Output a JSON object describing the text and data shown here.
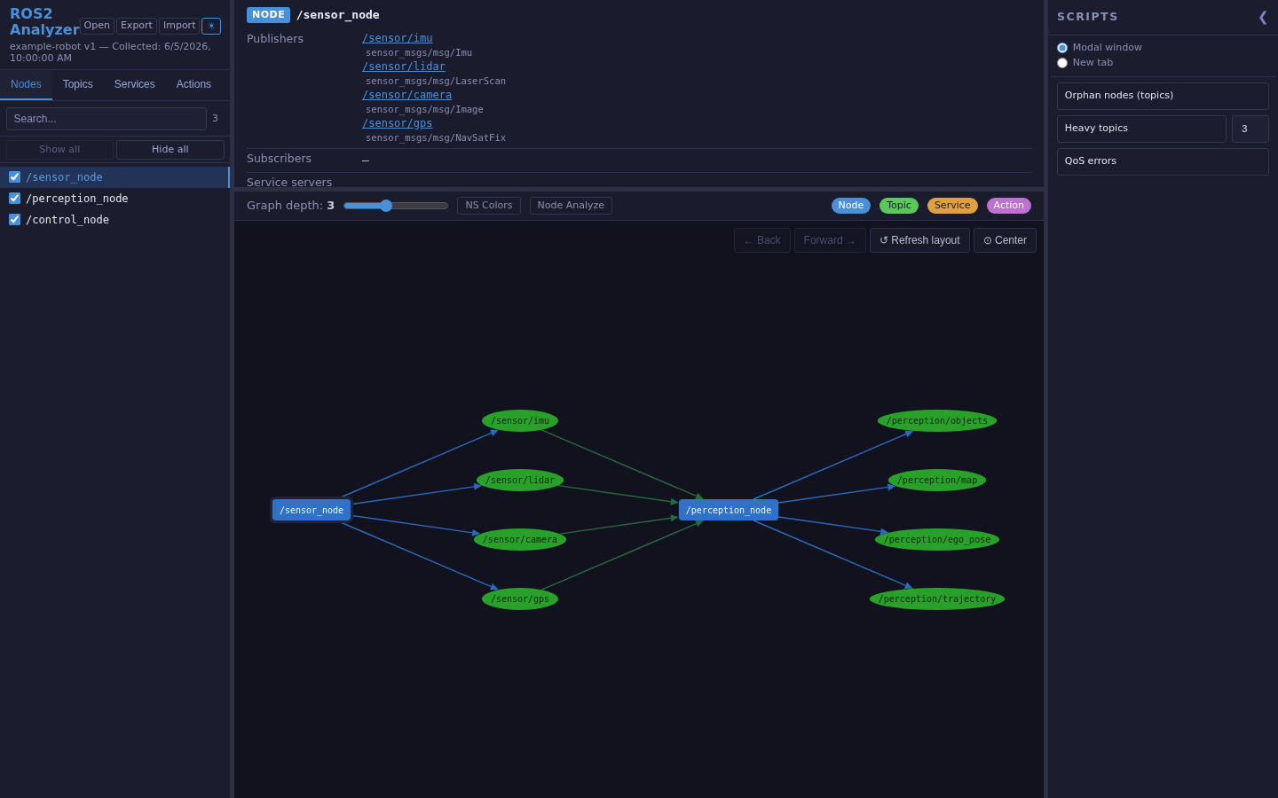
{
  "app": {
    "title": "ROS2 Analyzer",
    "subtitle": "example-robot v1 — Collected: 6/5/2026, 10:00:00 AM",
    "file_buttons": [
      "Open",
      "Export",
      "Import"
    ],
    "theme_toggle": "☀"
  },
  "tabs": [
    {
      "label": "Nodes",
      "selected": true
    },
    {
      "label": "Topics",
      "selected": false
    },
    {
      "label": "Services",
      "selected": false
    },
    {
      "label": "Actions",
      "selected": false
    }
  ],
  "search": {
    "placeholder": "Search...",
    "count": "3"
  },
  "visibility_buttons": [
    {
      "label": "Show all",
      "disabled": true
    },
    {
      "label": "Hide all",
      "disabled": false
    }
  ],
  "node_list": [
    {
      "label": "/sensor_node",
      "checked": true,
      "selected": true
    },
    {
      "label": "/perception_node",
      "checked": true,
      "selected": false
    },
    {
      "label": "/control_node",
      "checked": true,
      "selected": false
    }
  ],
  "details": {
    "badge": "NODE",
    "title": "/sensor_node",
    "sections": [
      {
        "label": "Publishers",
        "items": [
          {
            "topic": "/sensor/imu",
            "type": "sensor_msgs/msg/Imu"
          },
          {
            "topic": "/sensor/lidar",
            "type": "sensor_msgs/msg/LaserScan"
          },
          {
            "topic": "/sensor/camera",
            "type": "sensor_msgs/msg/Image"
          },
          {
            "topic": "/sensor/gps",
            "type": "sensor_msgs/msg/NavSatFix"
          }
        ]
      },
      {
        "label": "Subscribers",
        "empty": "–"
      },
      {
        "label": "Service servers"
      }
    ]
  },
  "toolbar": {
    "depth_label": "Graph depth:",
    "depth_value": "3",
    "depth_slider": {
      "level": 0.4
    },
    "buttons": [
      "NS Colors",
      "Node Analyze"
    ],
    "legend": [
      {
        "label": "Node",
        "color": "#4a90d9"
      },
      {
        "label": "Topic",
        "color": "#5ac85a"
      },
      {
        "label": "Service",
        "color": "#e0a040"
      },
      {
        "label": "Action",
        "color": "#c070d0"
      }
    ]
  },
  "graph_buttons": [
    {
      "label": "← Back",
      "disabled": true
    },
    {
      "label": "Forward →",
      "disabled": true
    },
    {
      "label": "↺ Refresh layout",
      "disabled": false
    },
    {
      "label": "⊙ Center",
      "disabled": false
    }
  ],
  "graph": {
    "stages": [
      {
        "node": {
          "label": "/sensor_node",
          "selected": true
        },
        "published_topics": [
          {
            "label": "/sensor/imu"
          },
          {
            "label": "/sensor/lidar"
          },
          {
            "label": "/sensor/camera"
          },
          {
            "label": "/sensor/gps"
          }
        ]
      },
      {
        "node": {
          "label": "/perception_node",
          "selected": false
        },
        "published_topics": [
          {
            "label": "/perception/objects"
          },
          {
            "label": "/perception/map"
          },
          {
            "label": "/perception/ego_pose"
          },
          {
            "label": "/perception/trajectory"
          }
        ]
      }
    ]
  },
  "scripts": {
    "title": "SCRIPTS",
    "collapse": "❮",
    "open_mode": [
      {
        "label": "Modal window",
        "selected": true
      },
      {
        "label": "New tab",
        "selected": false
      }
    ],
    "items": [
      {
        "label": "Orphan nodes (topics)"
      },
      {
        "label": "Heavy topics",
        "param": "3"
      },
      {
        "label": "QoS errors"
      }
    ]
  }
}
